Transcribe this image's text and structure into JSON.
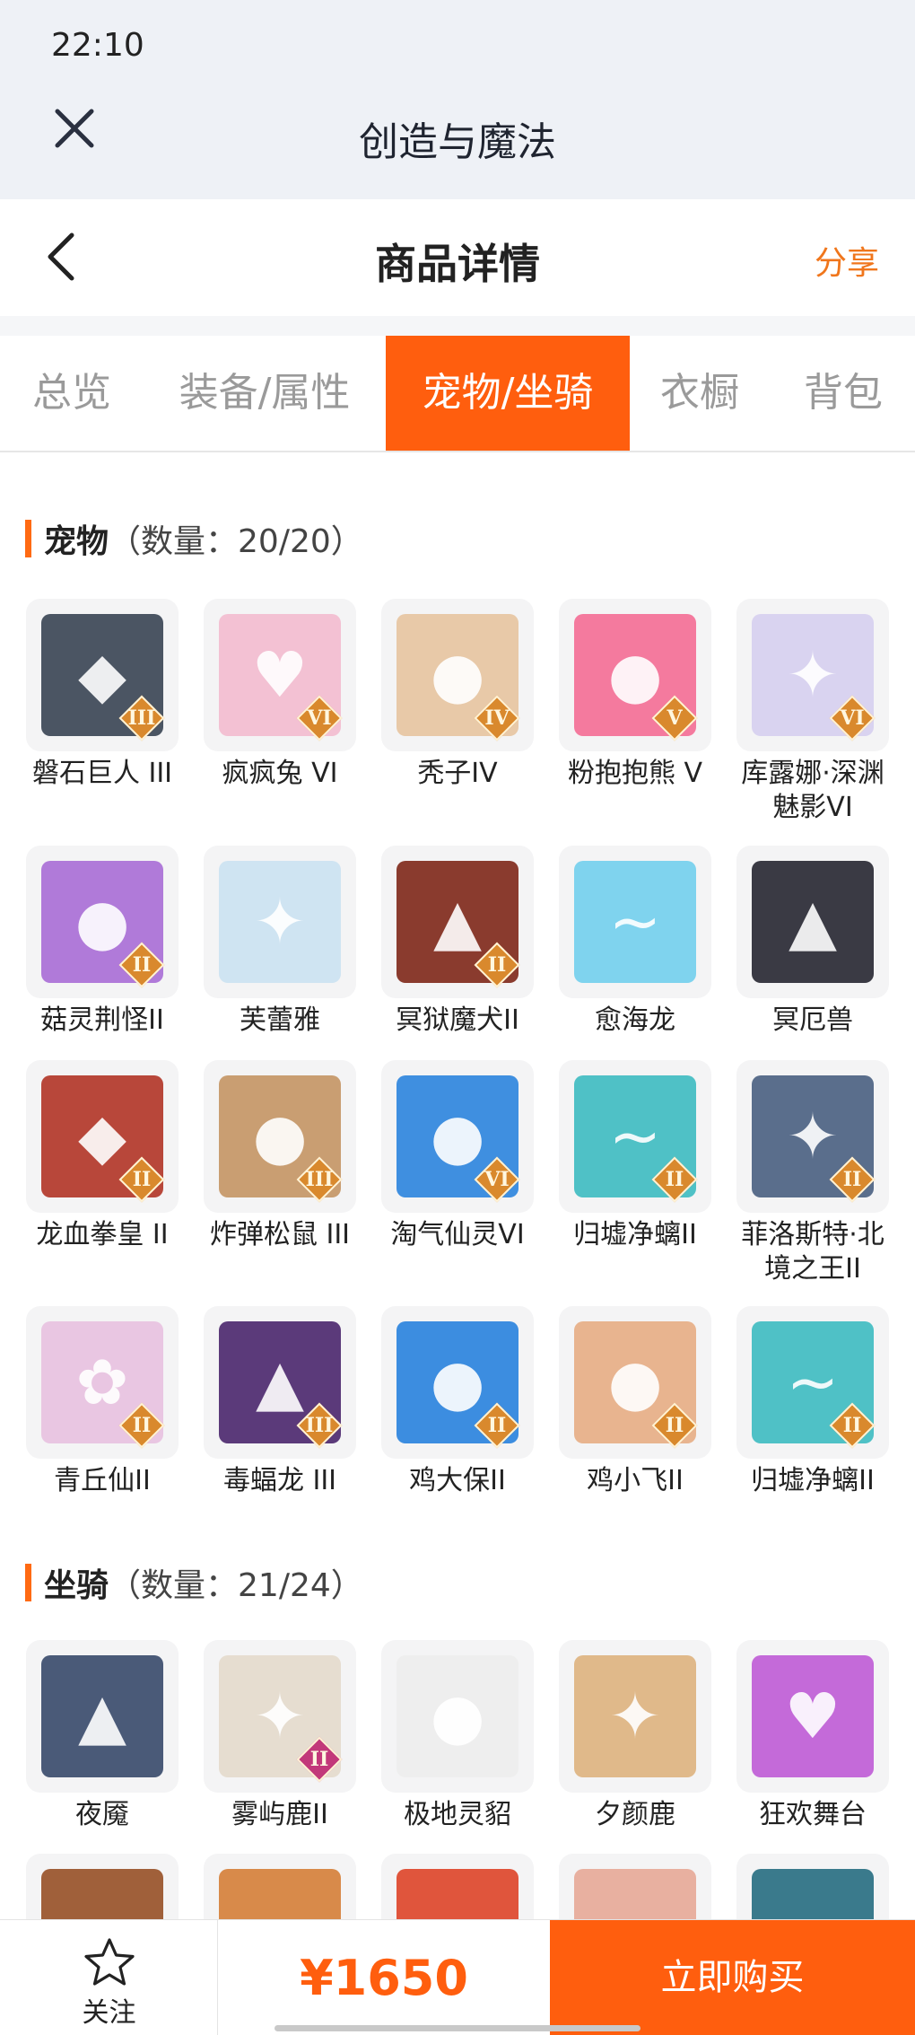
{
  "status": {
    "time": "22:10"
  },
  "appbar": {
    "title": "创造与魔法",
    "close_icon": "close-icon"
  },
  "header": {
    "title": "商品详情",
    "share": "分享",
    "back_icon": "chevron-left-icon"
  },
  "tabs": [
    {
      "label": "总览",
      "active": false
    },
    {
      "label": "装备/属性",
      "active": false
    },
    {
      "label": "宠物/坐骑",
      "active": true
    },
    {
      "label": "衣橱",
      "active": false
    },
    {
      "label": "背包",
      "active": false
    }
  ],
  "pets": {
    "title": "宠物",
    "count": "（数量：20/20）",
    "items": [
      {
        "name": "磐石巨人 III",
        "tier": "III",
        "color": "#4b5563",
        "glyph": "◆"
      },
      {
        "name": "疯疯兔 VI",
        "tier": "VI",
        "color": "#f3c1d3",
        "glyph": "♥"
      },
      {
        "name": "秃子IV",
        "tier": "IV",
        "color": "#e8c9a8",
        "glyph": "●"
      },
      {
        "name": "粉抱抱熊 V",
        "tier": "V",
        "color": "#f47a9e",
        "glyph": "●"
      },
      {
        "name": "库露娜·深渊魅影VI",
        "tier": "VI",
        "color": "#d9d3f0",
        "glyph": "✦"
      },
      {
        "name": "菇灵荆怪II",
        "tier": "II",
        "color": "#b07ad9",
        "glyph": "●"
      },
      {
        "name": "芙蕾雅",
        "tier": "",
        "color": "#cfe4f2",
        "glyph": "✦"
      },
      {
        "name": "冥狱魔犬II",
        "tier": "II",
        "color": "#8a3b2e",
        "glyph": "▲"
      },
      {
        "name": "愈海龙",
        "tier": "",
        "color": "#7fd3ee",
        "glyph": "~"
      },
      {
        "name": "冥厄兽",
        "tier": "",
        "color": "#3a3a44",
        "glyph": "▲"
      },
      {
        "name": "龙血拳皇 II",
        "tier": "II",
        "color": "#b8473a",
        "glyph": "◆"
      },
      {
        "name": "炸弹松鼠 III",
        "tier": "III",
        "color": "#c99e72",
        "glyph": "●"
      },
      {
        "name": "淘气仙灵VI",
        "tier": "VI",
        "color": "#3f8fe0",
        "glyph": "●"
      },
      {
        "name": "归墟净螭II",
        "tier": "II",
        "color": "#4fc1c6",
        "glyph": "~"
      },
      {
        "name": "菲洛斯特·北境之王II",
        "tier": "II",
        "color": "#5a6e8c",
        "glyph": "✦"
      },
      {
        "name": "青丘仙II",
        "tier": "II",
        "color": "#e9c6e2",
        "glyph": "✿"
      },
      {
        "name": "毒蝠龙 III",
        "tier": "III",
        "color": "#5b3a7a",
        "glyph": "▲"
      },
      {
        "name": "鸡大保II",
        "tier": "II",
        "color": "#3c8de0",
        "glyph": "●"
      },
      {
        "name": "鸡小飞II",
        "tier": "II",
        "color": "#e8b48f",
        "glyph": "●"
      },
      {
        "name": "归墟净螭II",
        "tier": "II",
        "color": "#4fc1c6",
        "glyph": "~"
      }
    ]
  },
  "mounts": {
    "title": "坐骑",
    "count": "（数量：21/24）",
    "items": [
      {
        "name": "夜魇",
        "tier": "",
        "color": "#4a5a78",
        "glyph": "▲"
      },
      {
        "name": "雾屿鹿II",
        "tier": "II",
        "color": "#e6ddd0",
        "glyph": "✦"
      },
      {
        "name": "极地灵貂",
        "tier": "",
        "color": "#eeeeee",
        "glyph": "●"
      },
      {
        "name": "夕颜鹿",
        "tier": "",
        "color": "#e0b98a",
        "glyph": "✦"
      },
      {
        "name": "狂欢舞台",
        "tier": "",
        "color": "#c46ad9",
        "glyph": "♥"
      }
    ],
    "partial_colors": [
      "#a0603a",
      "#d88a4a",
      "#e0553c",
      "#e8b0a0",
      "#3a7a8c"
    ]
  },
  "bottom": {
    "follow": "关注",
    "price": "¥1650",
    "buy": "立即购买",
    "star_icon": "star-icon"
  }
}
